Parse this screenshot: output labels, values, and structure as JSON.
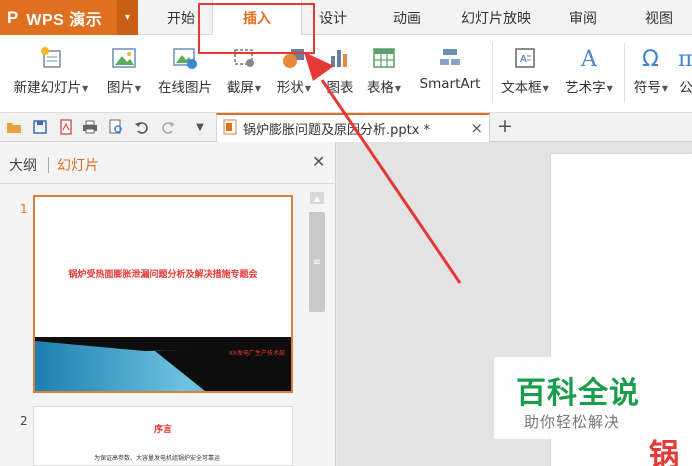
{
  "app": {
    "logo": "P",
    "name": "WPS 演示",
    "caret": "▾"
  },
  "menu_tabs": [
    "开始",
    "插入",
    "设计",
    "动画",
    "幻灯片放映",
    "审阅",
    "视图"
  ],
  "ribbon": {
    "new_slide": "新建幻灯片",
    "picture": "图片",
    "online_picture": "在线图片",
    "screenshot": "截屏",
    "shapes": "形状",
    "chart": "图表",
    "table": "表格",
    "smartart": "SmartArt",
    "textbox": "文本框",
    "wordart": "艺术字",
    "symbol": "符号",
    "formula": "公"
  },
  "document": {
    "title": "锅炉膨胀问题及原因分析.pptx *"
  },
  "left_panel": {
    "tab_outline": "大纲",
    "tab_slides": "幻灯片"
  },
  "slides": [
    {
      "number": "1",
      "title": "锅炉受热面膨胀泄漏问题分析及解决措施专题会",
      "subtitle": "XX发电厂生产技术部"
    },
    {
      "number": "2",
      "title": "序言",
      "body": "为保证高参数、大容量发电机组锅炉安全可靠运"
    }
  ],
  "canvas": {
    "visible_char": "锅"
  },
  "watermark": {
    "title": "百科全说",
    "subtitle": "助你轻松解决"
  },
  "colors": {
    "accent": "#e0701f",
    "highlight": "#e53935",
    "watermark_green": "#1a9e4b"
  }
}
